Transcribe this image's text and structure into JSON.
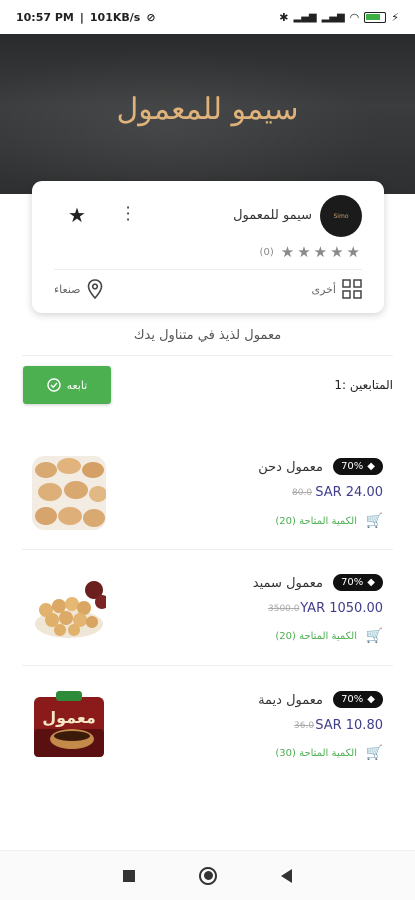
{
  "status_bar": {
    "time": "10:57 PM",
    "speed": "101KB/s",
    "battery": "87"
  },
  "banner": {
    "title": "سيمو للمعمول"
  },
  "store": {
    "name": "سيمو للمعمول",
    "logo_text": "Simo",
    "rating_count": "(0)",
    "location": "صنعاء",
    "category": "أخرى"
  },
  "tagline": "معمول لذيذ في متناول يدك",
  "follow": {
    "button_label": "تابعه",
    "followers_label": "المتابعين :1"
  },
  "products": [
    {
      "name": "معمول دحن",
      "discount": "70%",
      "price": "SAR 24.00",
      "old_price": "80.0",
      "qty": "الكمية المتاحة (20)",
      "image": "maamoul-dates"
    },
    {
      "name": "معمول سميد",
      "discount": "70%",
      "price": "YAR 1050.00",
      "old_price": "3500.0",
      "qty": "الكمية المتاحة (20)",
      "image": "maamoul-semolina"
    },
    {
      "name": "معمول ديمة",
      "discount": "70%",
      "price": "SAR 10.80",
      "old_price": "36.0",
      "qty": "الكمية المتاحة (30)",
      "image": "maamoul-package"
    }
  ],
  "icons": {
    "menu": "more-vert-icon",
    "favorite": "star-check-icon",
    "location": "location-pin-icon",
    "category": "grid-icon",
    "follow": "check-circle-icon",
    "cart": "cart-icon",
    "tag": "tag-icon"
  },
  "colors": {
    "accent_green": "#4caf50",
    "price_color": "#3f3d8a",
    "banner_text": "#e0b37a",
    "pager": "#7a6fd6"
  }
}
